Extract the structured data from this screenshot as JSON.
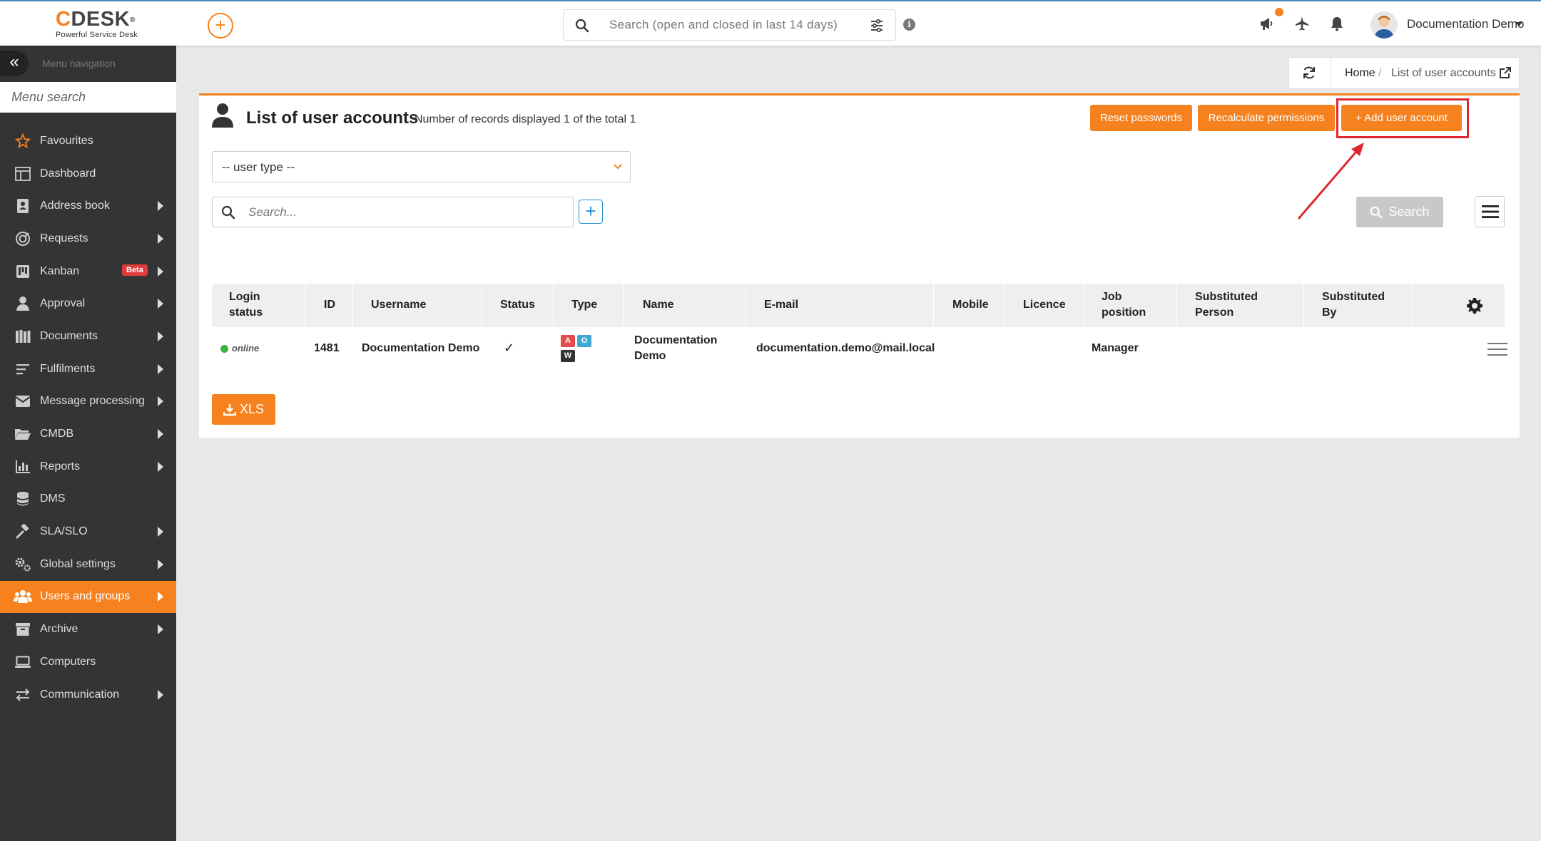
{
  "app": {
    "logo_brand": "CDESK",
    "logo_c": "C",
    "logo_rest": "DESK",
    "logo_reg": "®",
    "logo_tagline": "Powerful Service Desk",
    "global_search_placeholder": "Search (open and closed in last 14 days)",
    "user_name": "Documentation Demo"
  },
  "sidebar": {
    "title": "Menu navigation",
    "search_placeholder": "Menu search",
    "items": [
      {
        "label": "Favourites",
        "icon": "star-icon",
        "arrow": false
      },
      {
        "label": "Dashboard",
        "icon": "dashboard-icon",
        "arrow": false
      },
      {
        "label": "Address book",
        "icon": "address-book-icon",
        "arrow": true
      },
      {
        "label": "Requests",
        "icon": "requests-icon",
        "arrow": true
      },
      {
        "label": "Kanban",
        "icon": "kanban-icon",
        "arrow": true,
        "badge": "Beta"
      },
      {
        "label": "Approval",
        "icon": "user-icon",
        "arrow": true
      },
      {
        "label": "Documents",
        "icon": "documents-icon",
        "arrow": true
      },
      {
        "label": "Fulfilments",
        "icon": "lines-icon",
        "arrow": true
      },
      {
        "label": "Message processing",
        "icon": "envelope-icon",
        "arrow": true
      },
      {
        "label": "CMDB",
        "icon": "folder-icon",
        "arrow": true
      },
      {
        "label": "Reports",
        "icon": "chart-icon",
        "arrow": true
      },
      {
        "label": "DMS",
        "icon": "database-icon",
        "arrow": false
      },
      {
        "label": "SLA/SLO",
        "icon": "gavel-icon",
        "arrow": true
      },
      {
        "label": "Global settings",
        "icon": "cogs-icon",
        "arrow": true
      },
      {
        "label": "Users and groups",
        "icon": "users-icon",
        "arrow": true,
        "active": true
      },
      {
        "label": "Archive",
        "icon": "archive-icon",
        "arrow": true
      },
      {
        "label": "Computers",
        "icon": "laptop-icon",
        "arrow": false
      },
      {
        "label": "Communication",
        "icon": "exchange-icon",
        "arrow": true
      }
    ]
  },
  "breadcrumb": {
    "home": "Home",
    "separator": "/",
    "current": "List of user accounts"
  },
  "page": {
    "title": "List of user accounts",
    "subtitle": "Number of records displayed 1 of the total 1",
    "reset_label": "Reset passwords",
    "recalc_label": "Recalculate permissions",
    "add_label": "+ Add user account",
    "user_type_label": "-- user type --",
    "search_placeholder": "Search...",
    "search_button": "Search",
    "xls_label": "XLS"
  },
  "table": {
    "headers": [
      "Login status",
      "ID",
      "Username",
      "Status",
      "Type",
      "Name",
      "E-mail",
      "Mobile",
      "Licence",
      "Job position",
      "Substituted Person",
      "Substituted By"
    ],
    "header_lines": {
      "login_1": "Login",
      "login_2": "status",
      "job_1": "Job",
      "job_2": "position",
      "sp_1": "Substituted",
      "sp_2": "Person",
      "sb_1": "Substituted",
      "sb_2": "By"
    },
    "rows": [
      {
        "login_status": "online",
        "id": "1481",
        "username": "Documentation Demo",
        "status": "✓",
        "type_badges": [
          "A",
          "O",
          "W"
        ],
        "name_1": "Documentation",
        "name_2": "Demo",
        "email": "documentation.demo@mail.local",
        "mobile": "",
        "licence": "",
        "job_position": "Manager",
        "substituted_person": "",
        "substituted_by": ""
      }
    ]
  },
  "colors": {
    "accent": "#f5821f",
    "sidebar": "#343434",
    "highlight": "#e0262e",
    "badge_a": "#e54b4b",
    "badge_o": "#3fa9d6",
    "badge_w": "#333333",
    "online": "#3cb043"
  }
}
